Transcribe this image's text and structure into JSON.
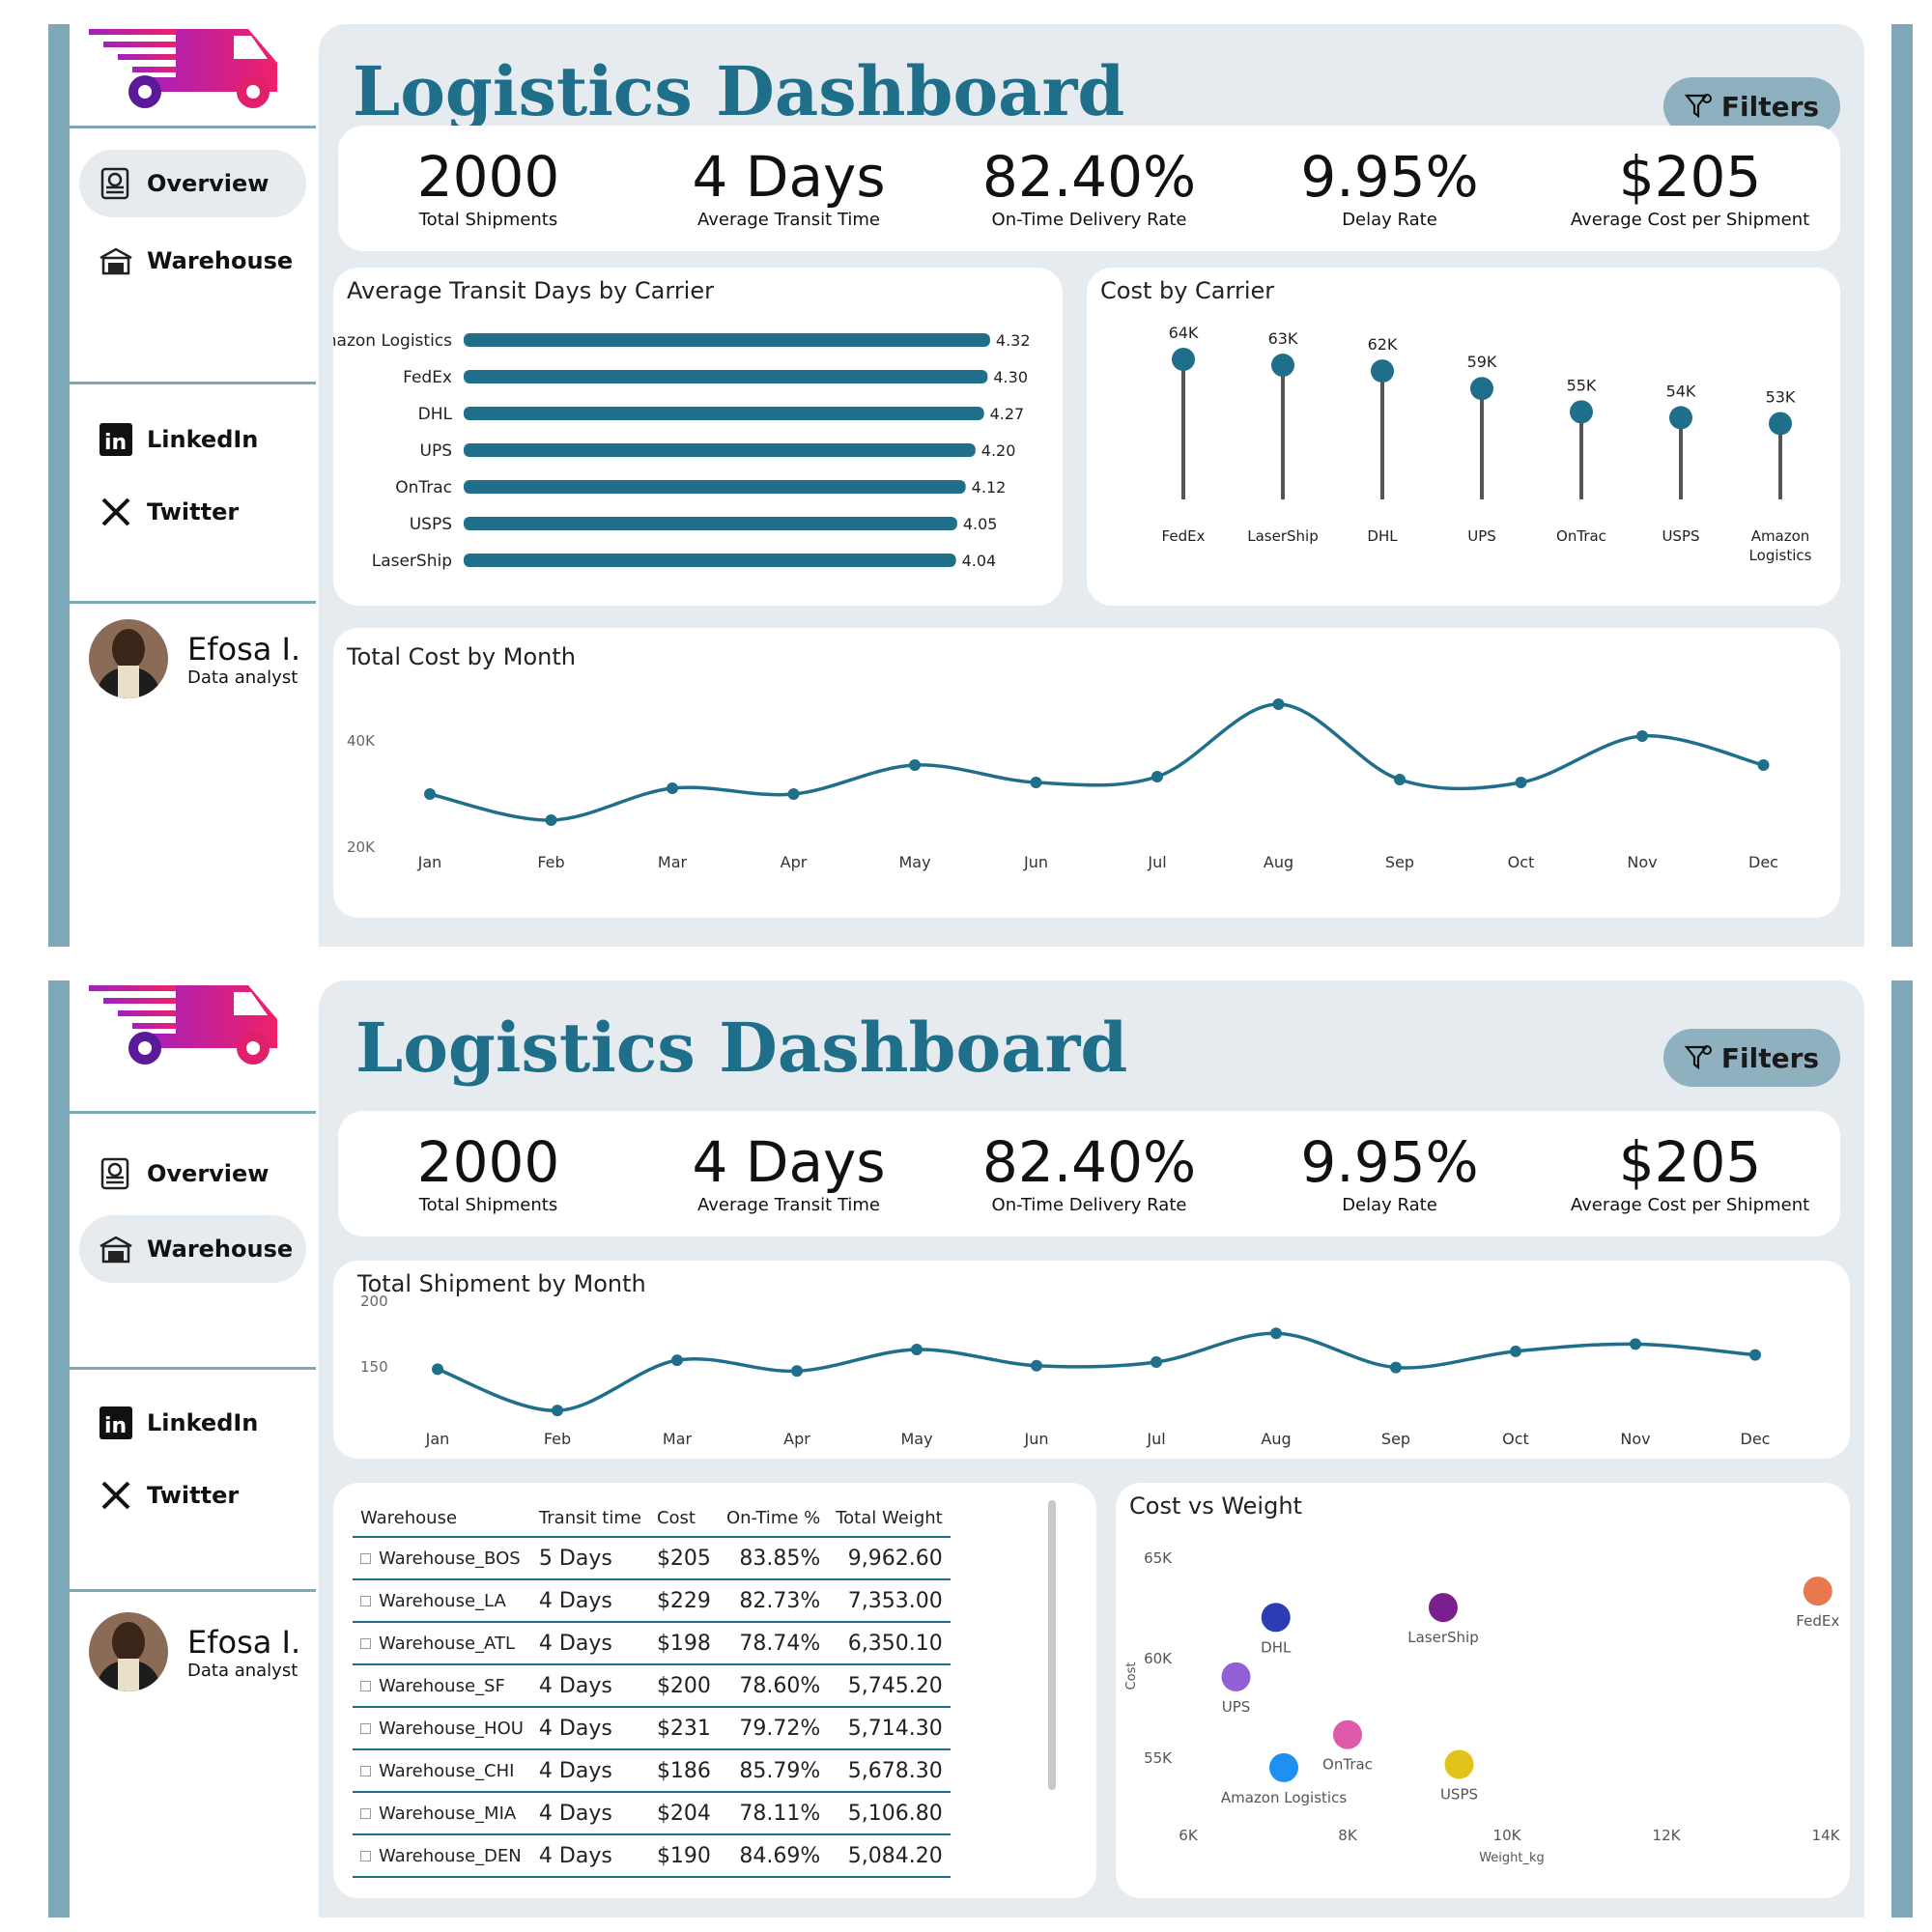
{
  "app_title": "Logistics Dashboard",
  "filters_label": "Filters",
  "nav": {
    "overview": "Overview",
    "warehouse": "Warehouse",
    "linkedin": "LinkedIn",
    "twitter": "Twitter"
  },
  "profile": {
    "name": "Efosa I.",
    "role": "Data analyst"
  },
  "kpis": [
    {
      "value": "2000",
      "label": "Total Shipments"
    },
    {
      "value": "4 Days",
      "label": "Average Transit Time"
    },
    {
      "value": "82.40%",
      "label": "On-Time Delivery Rate"
    },
    {
      "value": "9.95%",
      "label": "Delay Rate"
    },
    {
      "value": "$205",
      "label": "Average Cost per Shipment"
    }
  ],
  "colors": {
    "accent": "#1f6f8b",
    "frame": "#7ea7b8",
    "panel": "#e6ebef"
  },
  "chart_data": [
    {
      "title": "Average Transit Days by Carrier",
      "type": "bar",
      "categories": [
        "Amazon Logistics",
        "FedEx",
        "DHL",
        "UPS",
        "OnTrac",
        "USPS",
        "LaserShip"
      ],
      "values": [
        4.32,
        4.3,
        4.27,
        4.2,
        4.12,
        4.05,
        4.04
      ],
      "data_labels": [
        "4.32",
        "4.30",
        "4.27",
        "4.20",
        "4.12",
        "4.05",
        "4.04"
      ],
      "orientation": "horizontal"
    },
    {
      "title": "Cost by Carrier",
      "type": "lollipop",
      "categories": [
        "FedEx",
        "LaserShip",
        "DHL",
        "UPS",
        "OnTrac",
        "USPS",
        "Amazon Logistics"
      ],
      "values": [
        64000,
        63000,
        62000,
        59000,
        55000,
        54000,
        53000
      ],
      "data_labels": [
        "64K",
        "63K",
        "62K",
        "59K",
        "55K",
        "54K",
        "53K"
      ]
    },
    {
      "title": "Total Cost by Month",
      "type": "line",
      "categories": [
        "Jan",
        "Feb",
        "Mar",
        "Apr",
        "May",
        "Jun",
        "Jul",
        "Aug",
        "Sep",
        "Oct",
        "Nov",
        "Dec"
      ],
      "values": [
        33000,
        28500,
        34000,
        33000,
        38000,
        35000,
        36000,
        48500,
        35500,
        35000,
        43000,
        38000
      ],
      "y_ticks": [
        "40K",
        "20K"
      ],
      "ylim": [
        20000,
        50000
      ]
    },
    {
      "title": "Total Shipment by Month",
      "type": "line",
      "categories": [
        "Jan",
        "Feb",
        "Mar",
        "Apr",
        "May",
        "Jun",
        "Jul",
        "Aug",
        "Sep",
        "Oct",
        "Nov",
        "Dec"
      ],
      "values": [
        161,
        138,
        166,
        160,
        172,
        163,
        165,
        181,
        162,
        171,
        175,
        169
      ],
      "y_ticks": [
        "200",
        "150"
      ],
      "ylim": [
        130,
        200
      ]
    },
    {
      "title": "Cost vs Weight",
      "type": "scatter",
      "xlabel": "Weight_kg",
      "ylabel": "Cost",
      "x_ticks": [
        "6K",
        "8K",
        "10K",
        "12K",
        "14K"
      ],
      "y_ticks": [
        "65K",
        "60K",
        "55K"
      ],
      "xlim": [
        6000,
        14000
      ],
      "ylim": [
        53000,
        65000
      ],
      "points": [
        {
          "name": "FedEx",
          "x": 13900,
          "y": 64000,
          "color": "#e8784e"
        },
        {
          "name": "LaserShip",
          "x": 9200,
          "y": 63000,
          "color": "#7a1f8f"
        },
        {
          "name": "DHL",
          "x": 7100,
          "y": 62400,
          "color": "#2b3cb4"
        },
        {
          "name": "UPS",
          "x": 6600,
          "y": 58800,
          "color": "#9060d6"
        },
        {
          "name": "OnTrac",
          "x": 8000,
          "y": 55300,
          "color": "#e05aac"
        },
        {
          "name": "USPS",
          "x": 9400,
          "y": 53500,
          "color": "#e3c21a"
        },
        {
          "name": "Amazon Logistics",
          "x": 7200,
          "y": 53300,
          "color": "#1f90ef"
        }
      ]
    }
  ],
  "warehouse_table": {
    "headers": [
      "Warehouse",
      "Transit time",
      "Cost",
      "On-Time %",
      "Total Weight"
    ],
    "rows": [
      [
        "Warehouse_BOS",
        "5 Days",
        "$205",
        "83.85%",
        "9,962.60"
      ],
      [
        "Warehouse_LA",
        "4 Days",
        "$229",
        "82.73%",
        "7,353.00"
      ],
      [
        "Warehouse_ATL",
        "4 Days",
        "$198",
        "78.74%",
        "6,350.10"
      ],
      [
        "Warehouse_SF",
        "4 Days",
        "$200",
        "78.60%",
        "5,745.20"
      ],
      [
        "Warehouse_HOU",
        "4 Days",
        "$231",
        "79.72%",
        "5,714.30"
      ],
      [
        "Warehouse_CHI",
        "4 Days",
        "$186",
        "85.79%",
        "5,678.30"
      ],
      [
        "Warehouse_MIA",
        "4 Days",
        "$204",
        "78.11%",
        "5,106.80"
      ],
      [
        "Warehouse_DEN",
        "4 Days",
        "$190",
        "84.69%",
        "5,084.20"
      ]
    ]
  },
  "icons": [
    "truck-logo-icon",
    "overview-icon",
    "warehouse-icon",
    "linkedin-icon",
    "twitter-x-icon",
    "filter-icon"
  ]
}
